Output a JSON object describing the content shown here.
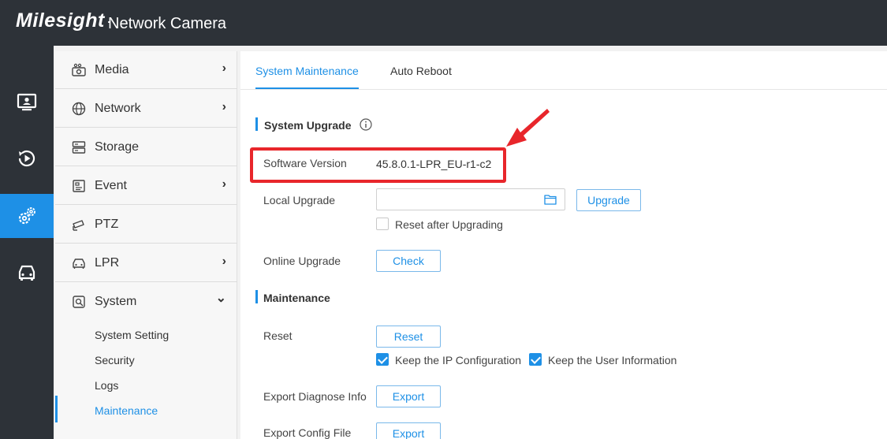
{
  "header": {
    "brand": "Milesight",
    "product": "Network Camera"
  },
  "rail": {
    "items": [
      {
        "icon": "monitor-icon",
        "active": false
      },
      {
        "icon": "playback-icon",
        "active": false
      },
      {
        "icon": "settings-gear-icon",
        "active": true
      },
      {
        "icon": "car-icon",
        "active": false
      }
    ]
  },
  "menu": {
    "items": [
      {
        "label": "Media",
        "icon": "camera-icon",
        "chevron": "›"
      },
      {
        "label": "Network",
        "icon": "globe-icon",
        "chevron": "›"
      },
      {
        "label": "Storage",
        "icon": "storage-icon",
        "chevron": ""
      },
      {
        "label": "Event",
        "icon": "event-icon",
        "chevron": "›"
      },
      {
        "label": "PTZ",
        "icon": "ptz-icon",
        "chevron": ""
      },
      {
        "label": "LPR",
        "icon": "car-icon",
        "chevron": "›"
      },
      {
        "label": "System",
        "icon": "system-icon",
        "chevron": "⌄"
      }
    ],
    "system_sub": [
      "System Setting",
      "Security",
      "Logs",
      "Maintenance"
    ],
    "active_sub": "Maintenance"
  },
  "tabs": {
    "items": [
      "System Maintenance",
      "Auto Reboot"
    ],
    "active": "System Maintenance"
  },
  "system_upgrade": {
    "title": "System Upgrade",
    "software_version_label": "Software Version",
    "software_version_value": "45.8.0.1-LPR_EU-r1-c2",
    "local_upgrade_label": "Local Upgrade",
    "upgrade_button": "Upgrade",
    "reset_after_upgrading_label": "Reset after Upgrading",
    "reset_after_upgrading_checked": false,
    "online_upgrade_label": "Online Upgrade",
    "check_button": "Check"
  },
  "maintenance": {
    "title": "Maintenance",
    "reset_label": "Reset",
    "reset_button": "Reset",
    "keep_ip_label": "Keep the IP Configuration",
    "keep_ip_checked": true,
    "keep_user_label": "Keep the User Information",
    "keep_user_checked": true,
    "export_diag_label": "Export Diagnose Info",
    "export_diag_button": "Export",
    "export_config_label": "Export Config File",
    "export_config_button": "Export"
  },
  "colors": {
    "accent": "#1e90e6",
    "header_bg": "#2d3238",
    "annotation": "#e8262b"
  }
}
